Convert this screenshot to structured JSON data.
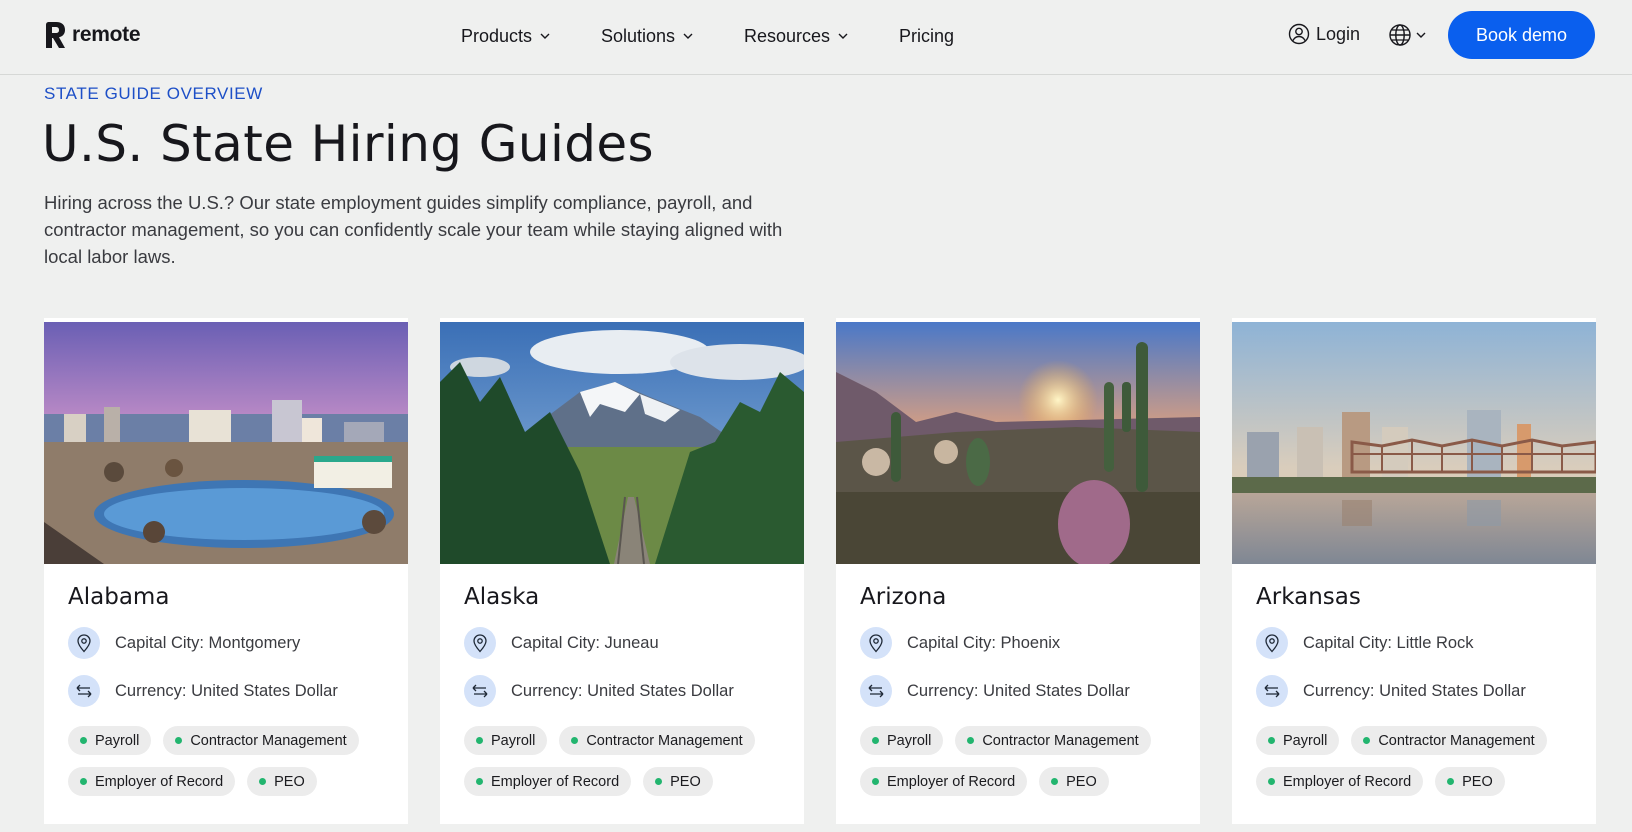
{
  "header": {
    "logo_text": "remote",
    "nav": [
      {
        "label": "Products",
        "dropdown": true
      },
      {
        "label": "Solutions",
        "dropdown": true
      },
      {
        "label": "Resources",
        "dropdown": true
      },
      {
        "label": "Pricing",
        "dropdown": false
      }
    ],
    "login_label": "Login",
    "book_demo_label": "Book demo"
  },
  "intro": {
    "eyebrow": "STATE GUIDE OVERVIEW",
    "title": "U.S. State Hiring Guides",
    "description": "Hiring across the U.S.? Our state employment guides simplify compliance, payroll, and contractor management, so you can confidently scale your team while staying aligned with local labor laws."
  },
  "cards": [
    {
      "state": "Alabama",
      "capital": "Capital City: Montgomery",
      "currency": "Currency: United States Dollar",
      "tags": [
        "Payroll",
        "Contractor Management",
        "Employer of Record",
        "PEO"
      ],
      "image": "city-skyline-park"
    },
    {
      "state": "Alaska",
      "capital": "Capital City: Juneau",
      "currency": "Currency: United States Dollar",
      "tags": [
        "Payroll",
        "Contractor Management",
        "Employer of Record",
        "PEO"
      ],
      "image": "mountain-railroad-forest"
    },
    {
      "state": "Arizona",
      "capital": "Capital City: Phoenix",
      "currency": "Currency: United States Dollar",
      "tags": [
        "Payroll",
        "Contractor Management",
        "Employer of Record",
        "PEO"
      ],
      "image": "desert-cactus-sunset"
    },
    {
      "state": "Arkansas",
      "capital": "Capital City: Little Rock",
      "currency": "Currency: United States Dollar",
      "tags": [
        "Payroll",
        "Contractor Management",
        "Employer of Record",
        "PEO"
      ],
      "image": "river-bridge-skyline"
    }
  ],
  "colors": {
    "accent": "#0a5fee",
    "eyebrow": "#1d4fc7",
    "tag_dot": "#22b56f",
    "icon_bg": "#d4e2f9",
    "page_bg": "#eff0ef"
  }
}
